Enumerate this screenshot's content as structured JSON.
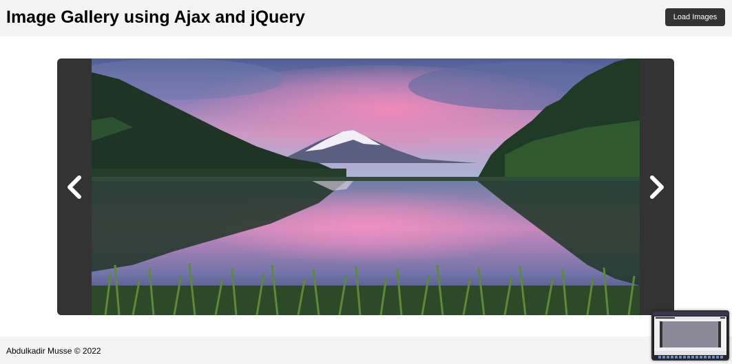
{
  "header": {
    "title": "Image Gallery using Ajax and jQuery",
    "load_button_label": "Load Images"
  },
  "gallery": {
    "prev_icon": "chevron-left-icon",
    "next_icon": "chevron-right-icon",
    "current_image": "mountain lake landscape with pink sunset sky"
  },
  "footer": {
    "copyright": "Abdulkadir Musse © 2022"
  },
  "colors": {
    "header_bg": "#f4f4f4",
    "button_bg": "#333333",
    "gallery_frame": "#333333",
    "button_text": "#ffffff"
  }
}
